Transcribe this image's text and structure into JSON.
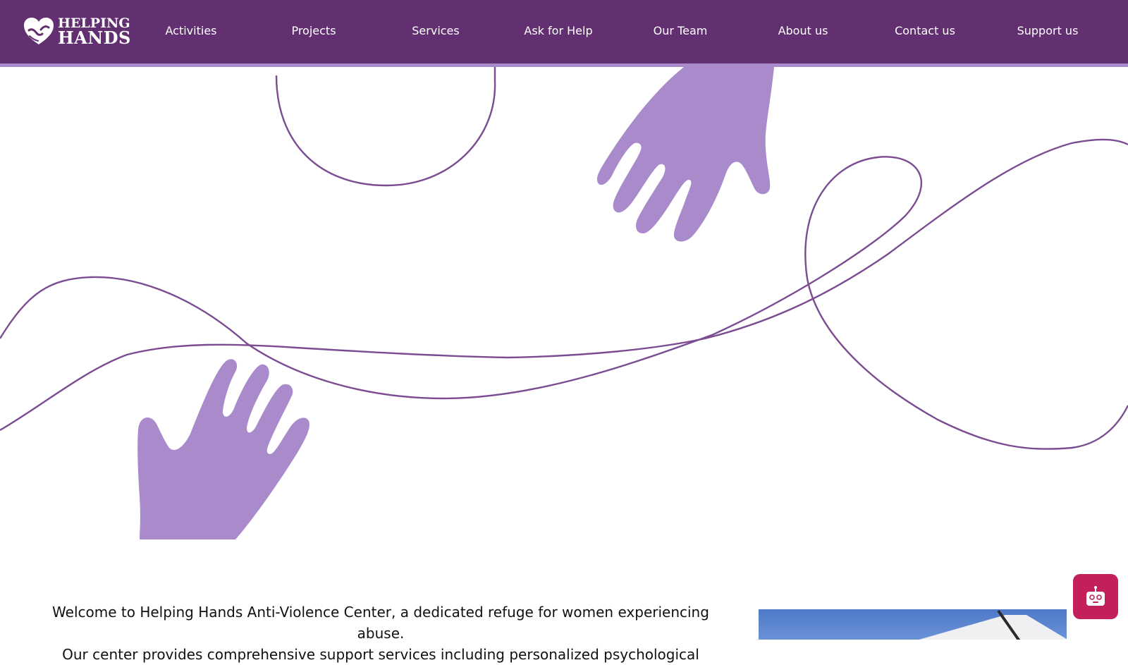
{
  "header": {
    "logo": {
      "line1": "HELPING",
      "line2": "HANDS"
    },
    "nav": [
      {
        "label": "Activities"
      },
      {
        "label": "Projects"
      },
      {
        "label": "Services"
      },
      {
        "label": "Ask for Help"
      },
      {
        "label": "Our Team"
      },
      {
        "label": "About us"
      },
      {
        "label": "Contact us"
      },
      {
        "label": "Support us"
      }
    ]
  },
  "main": {
    "intro_line1": "Welcome to Helping Hands Anti-Violence Center, a dedicated refuge for women experiencing abuse.",
    "intro_line2": "Our center provides comprehensive support services including personalized psychological"
  },
  "colors": {
    "header_bg": "#622f71",
    "header_border": "#a98bcc",
    "hand_fill": "#a98bcc",
    "line_stroke": "#7b4c92",
    "chat_button": "#c21f5b"
  },
  "icons": {
    "logo": "heart-hands-icon",
    "chat": "robot-icon"
  }
}
